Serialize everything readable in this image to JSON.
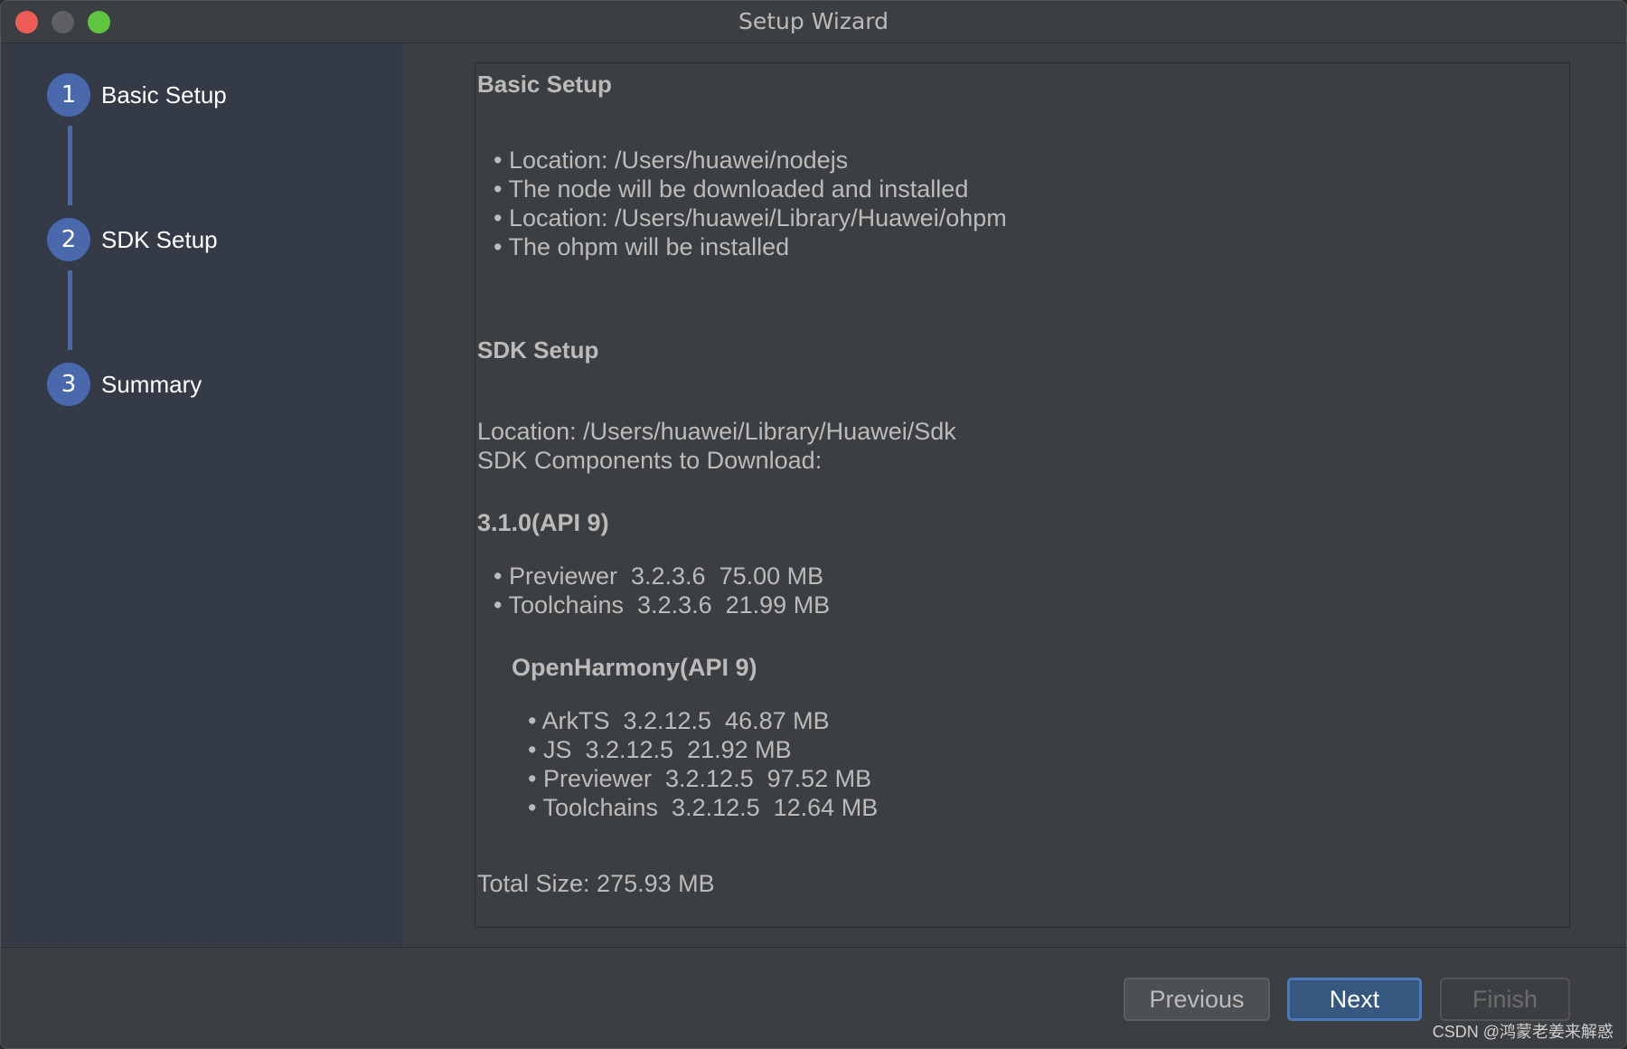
{
  "window": {
    "title": "Setup Wizard"
  },
  "sidebar": {
    "steps": [
      {
        "number": "1",
        "label": "Basic Setup"
      },
      {
        "number": "2",
        "label": "SDK Setup"
      },
      {
        "number": "3",
        "label": "Summary"
      }
    ]
  },
  "content": {
    "basic_setup": {
      "heading": "Basic Setup",
      "items": [
        "Location: /Users/huawei/nodejs",
        "The node will be downloaded and installed",
        "Location: /Users/huawei/Library/Huawei/ohpm",
        "The ohpm will be installed"
      ]
    },
    "sdk_setup": {
      "heading": "SDK Setup",
      "location": "Location: /Users/huawei/Library/Huawei/Sdk",
      "components_label": "SDK Components to Download:",
      "group1": {
        "title": "3.1.0(API 9)",
        "items": [
          "Previewer  3.2.3.6  75.00 MB",
          "Toolchains  3.2.3.6  21.99 MB"
        ]
      },
      "group2": {
        "title": "OpenHarmony(API 9)",
        "items": [
          "ArkTS  3.2.12.5  46.87 MB",
          "JS  3.2.12.5  21.92 MB",
          "Previewer  3.2.12.5  97.52 MB",
          "Toolchains  3.2.12.5  12.64 MB"
        ]
      },
      "total": "Total Size: 275.93 MB"
    }
  },
  "footer": {
    "previous_label": "Previous",
    "next_label": "Next",
    "finish_label": "Finish",
    "watermark": "CSDN @鸿蒙老姜来解惑"
  },
  "colors": {
    "accent": "#4a69ad",
    "background": "#3c3f41",
    "sidebar": "#343a46"
  }
}
